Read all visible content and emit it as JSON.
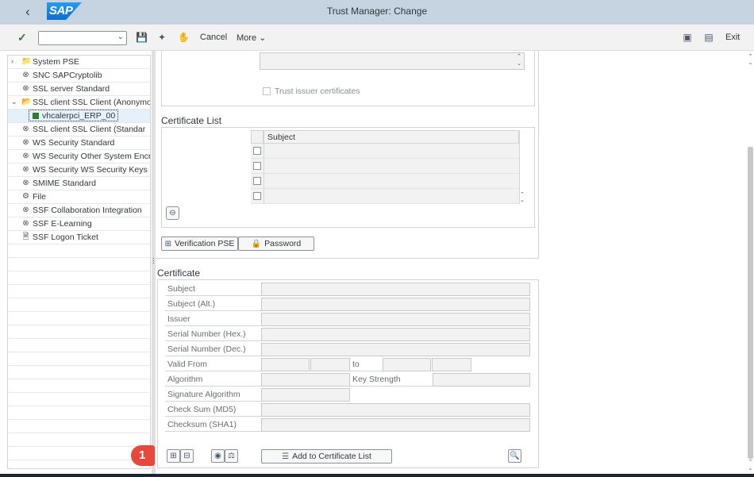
{
  "shell": {
    "back_icon": "chevron-left-icon",
    "logo_text": "SAP",
    "title": "Trust Manager: Change"
  },
  "toolbar": {
    "command_field_value": "",
    "cancel_label": "Cancel",
    "more_label": "More",
    "exit_label": "Exit"
  },
  "tree": {
    "items": [
      {
        "label": "System PSE",
        "icon": "folder-icon",
        "expander": ">"
      },
      {
        "label": "SNC SAPCryptolib",
        "icon": "x-circle-icon"
      },
      {
        "label": "SSL server Standard",
        "icon": "x-circle-icon"
      },
      {
        "label": "SSL client SSL Client (Anonymo",
        "icon": "folder-open-icon",
        "expander": "v"
      },
      {
        "label": "vhcalerpci_ERP_00",
        "icon": "green-square-icon",
        "selected": true
      },
      {
        "label": "SSL client SSL Client (Standar",
        "icon": "x-circle-icon"
      },
      {
        "label": "WS Security Standard",
        "icon": "x-circle-icon"
      },
      {
        "label": "WS Security Other System Encry",
        "icon": "x-circle-icon"
      },
      {
        "label": "WS Security WS Security Keys",
        "icon": "x-circle-icon"
      },
      {
        "label": "SMIME Standard",
        "icon": "x-circle-icon"
      },
      {
        "label": "File",
        "icon": "gear-icon"
      },
      {
        "label": "SSF Collaboration Integration",
        "icon": "x-circle-icon"
      },
      {
        "label": "SSF E-Learning",
        "icon": "x-circle-icon"
      },
      {
        "label": "SSF Logon Ticket",
        "icon": "x-circle-icon"
      }
    ]
  },
  "owner_section": {
    "trust_issuer_label": "Trust issuer certificates"
  },
  "certificate_list": {
    "title": "Certificate List",
    "column_subject": "Subject",
    "verification_pse_label": "Verification PSE",
    "password_label": "Password"
  },
  "certificate": {
    "title": "Certificate",
    "labels": {
      "subject": "Subject",
      "subject_alt": "Subject (Alt.)",
      "issuer": "Issuer",
      "serial_hex": "Serial Number (Hex.)",
      "serial_dec": "Serial Number (Dec.)",
      "valid_from": "Valid From",
      "to": "to",
      "algorithm": "Algorithm",
      "key_strength": "Key Strength",
      "signature_algorithm": "Signature Algorithm",
      "checksum_md5": "Check Sum (MD5)",
      "checksum_sha1": "Checksum (SHA1)"
    },
    "add_to_list_label": "Add to Certificate List"
  },
  "annotation": {
    "badge_number": "1"
  }
}
